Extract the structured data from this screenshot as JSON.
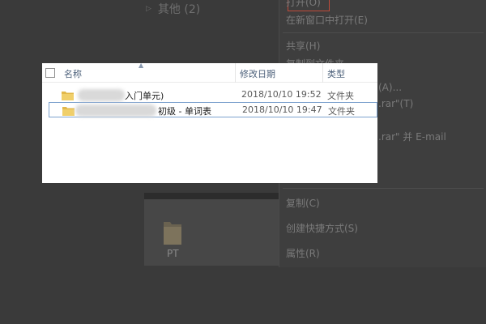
{
  "nav_pane": {
    "other_group": "其他 (2)"
  },
  "background_folder": {
    "label": "PT"
  },
  "context_menu": {
    "items": [
      {
        "label": "打开(O)"
      },
      {
        "label": "在新窗口中打开(E)"
      },
      {
        "label": "共享(H)"
      },
      {
        "label": "复制到文件夹"
      },
      {
        "label": "(A)..."
      },
      {
        "label": ".rar\"(T)"
      },
      {
        "label": ".rar\" 并 E-mail"
      },
      {
        "label": "复制(C)"
      },
      {
        "label": "创建快捷方式(S)"
      },
      {
        "label": "属性(R)"
      }
    ]
  },
  "file_list": {
    "columns": {
      "name": "名称",
      "date": "修改日期",
      "type": "类型"
    },
    "rows": [
      {
        "name_visible": "入门单元)",
        "date": "2018/10/10 19:52",
        "type": "文件夹",
        "selected": false
      },
      {
        "name_visible": "初级 - 单词表",
        "date": "2018/10/10 19:47",
        "type": "文件夹",
        "selected": true
      }
    ]
  },
  "colors": {
    "folder_yellow": "#e8c65a",
    "selection_border": "#7da2ce",
    "highlight_red": "#c04a3a",
    "header_text": "#4c607a"
  }
}
